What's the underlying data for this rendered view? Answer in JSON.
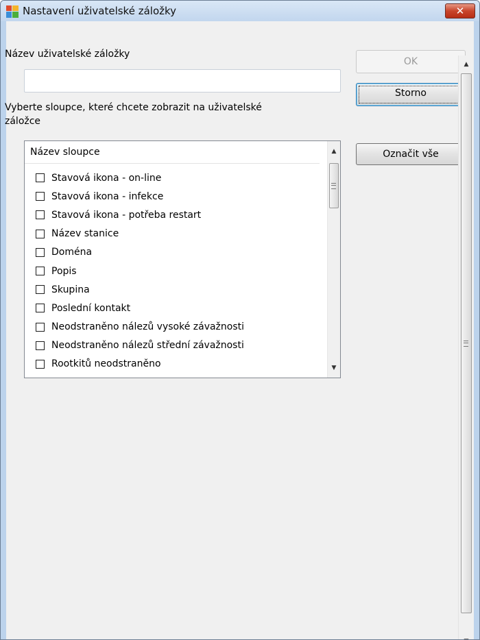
{
  "window": {
    "title": "Nastavení uživatelské záložky",
    "close_glyph": "✕"
  },
  "form": {
    "name_label": "Název uživatelské záložky",
    "name_value": "",
    "columns_label_line1": "Vyberte sloupce, které chcete zobrazit na uživatelské",
    "columns_label_line2": "záložce"
  },
  "list": {
    "header": "Název sloupce",
    "items": [
      {
        "label": "Stavová ikona - on-line",
        "checked": false
      },
      {
        "label": "Stavová ikona - infekce",
        "checked": false
      },
      {
        "label": "Stavová ikona - potřeba restart",
        "checked": false
      },
      {
        "label": "Název stanice",
        "checked": false
      },
      {
        "label": "Doména",
        "checked": false
      },
      {
        "label": "Popis",
        "checked": false
      },
      {
        "label": "Skupina",
        "checked": false
      },
      {
        "label": "Poslední kontakt",
        "checked": false
      },
      {
        "label": "Neodstraněno nálezů vysoké závažnosti",
        "checked": false
      },
      {
        "label": "Neodstraněno nálezů střední závažnosti",
        "checked": false
      },
      {
        "label": "Rootkitů neodstraněno",
        "checked": false
      }
    ]
  },
  "buttons": {
    "ok": "OK",
    "cancel": "Storno",
    "select_all": "Označit vše"
  },
  "icons": {
    "app": "avg-logo-icon",
    "close": "close-icon",
    "scroll_up": "scroll-up-icon",
    "scroll_down": "scroll-down-icon"
  },
  "colors": {
    "title_bar": "#c9dbf0",
    "close_button": "#c8452b",
    "default_button_border": "#3c7fb1"
  }
}
